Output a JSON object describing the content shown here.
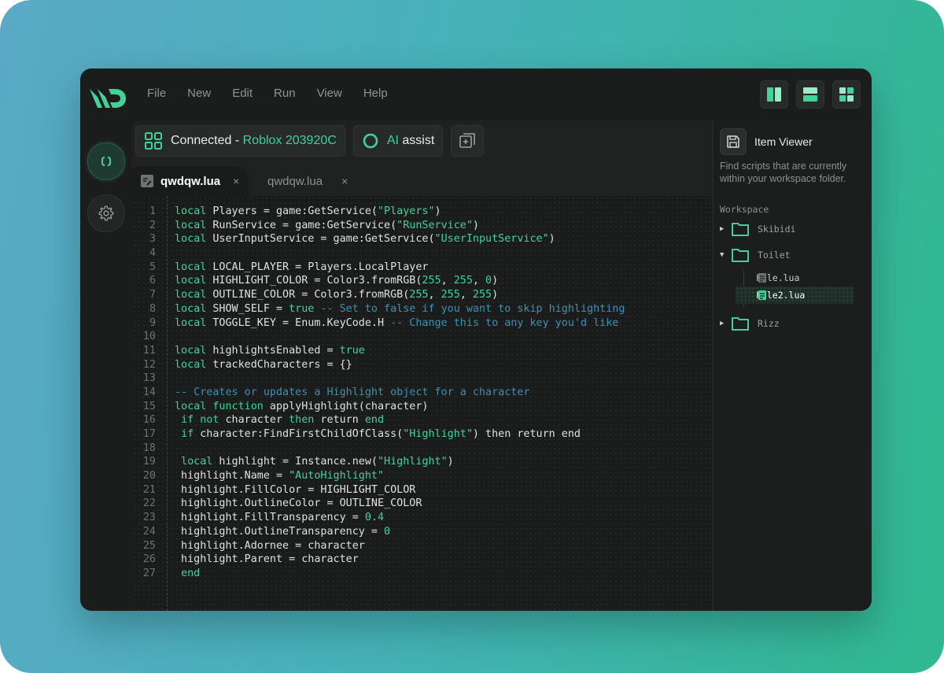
{
  "menu": [
    "File",
    "New",
    "Edit",
    "Run",
    "View",
    "Help"
  ],
  "toolbar": {
    "status_prefix": "Connected",
    "status_sep": " - ",
    "status_target": "Roblox 203920C",
    "ai_label_1": "AI",
    "ai_label_2": "assist"
  },
  "tabs": [
    {
      "name": "qwdqw.lua",
      "close": "×",
      "active": true
    },
    {
      "name": "qwdqw.lua",
      "close": "×",
      "active": false
    }
  ],
  "code_lines": [
    [
      [
        "kw",
        "local"
      ],
      [
        "p",
        " Players = game:GetService("
      ],
      [
        "str",
        "\"Players\""
      ],
      [
        "p",
        ")"
      ]
    ],
    [
      [
        "kw",
        "local"
      ],
      [
        "p",
        " RunService = game:GetService("
      ],
      [
        "str",
        "\"RunService\""
      ],
      [
        "p",
        ")"
      ]
    ],
    [
      [
        "kw",
        "local"
      ],
      [
        "p",
        " UserInputService = game:GetService("
      ],
      [
        "str",
        "\"UserInputService\""
      ],
      [
        "p",
        ")"
      ]
    ],
    [],
    [
      [
        "kw",
        "local"
      ],
      [
        "p",
        " LOCAL_PLAYER = Players.LocalPlayer"
      ]
    ],
    [
      [
        "kw",
        "local"
      ],
      [
        "p",
        " HIGHLIGHT_COLOR = Color3.fromRGB("
      ],
      [
        "num",
        "255"
      ],
      [
        "p",
        ", "
      ],
      [
        "num",
        "255"
      ],
      [
        "p",
        ", "
      ],
      [
        "num",
        "0"
      ],
      [
        "p",
        ")"
      ]
    ],
    [
      [
        "kw",
        "local"
      ],
      [
        "p",
        " OUTLINE_COLOR = Color3.fromRGB("
      ],
      [
        "num",
        "255"
      ],
      [
        "p",
        ", "
      ],
      [
        "num",
        "255"
      ],
      [
        "p",
        ", "
      ],
      [
        "num",
        "255"
      ],
      [
        "p",
        ")"
      ]
    ],
    [
      [
        "kw",
        "local"
      ],
      [
        "p",
        " SHOW_SELF = "
      ],
      [
        "kw",
        "true"
      ],
      [
        "p",
        " "
      ],
      [
        "cm",
        "-- Set to false if you want to skip highlighting"
      ]
    ],
    [
      [
        "kw",
        "local"
      ],
      [
        "p",
        " TOGGLE_KEY = Enum.KeyCode.H "
      ],
      [
        "cm",
        "-- Change this to any key you'd like"
      ]
    ],
    [],
    [
      [
        "kw",
        "local"
      ],
      [
        "p",
        " highlightsEnabled = "
      ],
      [
        "kw",
        "true"
      ]
    ],
    [
      [
        "kw",
        "local"
      ],
      [
        "p",
        " trackedCharacters = {}"
      ]
    ],
    [],
    [
      [
        "cm",
        "-- Creates or updates a Highlight object for a character"
      ]
    ],
    [
      [
        "kw",
        "local"
      ],
      [
        "p",
        " "
      ],
      [
        "kw",
        "function"
      ],
      [
        "p",
        " applyHighlight(character)"
      ]
    ],
    [
      [
        "p",
        " "
      ],
      [
        "kw",
        "if"
      ],
      [
        "p",
        " "
      ],
      [
        "kw",
        "not"
      ],
      [
        "p",
        " character "
      ],
      [
        "kw",
        "then"
      ],
      [
        "p",
        " return "
      ],
      [
        "kw",
        "end"
      ]
    ],
    [
      [
        "p",
        " "
      ],
      [
        "kw",
        "if"
      ],
      [
        "p",
        " character:FindFirstChildOfClass("
      ],
      [
        "str",
        "\"Highlight\""
      ],
      [
        "p",
        ") then return end"
      ]
    ],
    [],
    [
      [
        "p",
        " "
      ],
      [
        "kw",
        "local"
      ],
      [
        "p",
        " highlight = Instance.new("
      ],
      [
        "str",
        "\"Highlight\""
      ],
      [
        "p",
        ")"
      ]
    ],
    [
      [
        "p",
        " highlight.Name = "
      ],
      [
        "str",
        "\"AutoHighlight\""
      ]
    ],
    [
      [
        "p",
        " highlight.FillColor = HIGHLIGHT_COLOR"
      ]
    ],
    [
      [
        "p",
        " highlight.OutlineColor = OUTLINE_COLOR"
      ]
    ],
    [
      [
        "p",
        " highlight.FillTransparency = "
      ],
      [
        "num",
        "0.4"
      ]
    ],
    [
      [
        "p",
        " highlight.OutlineTransparency = "
      ],
      [
        "num",
        "0"
      ]
    ],
    [
      [
        "p",
        " highlight.Adornee = character"
      ]
    ],
    [
      [
        "p",
        " highlight.Parent = character"
      ]
    ],
    [
      [
        "p",
        " "
      ],
      [
        "kw",
        "end"
      ]
    ]
  ],
  "viewer": {
    "title": "Item Viewer",
    "description": "Find scripts that are currently within your workspace folder.",
    "workspace_label": "Workspace",
    "folders": [
      {
        "name": "Skibidi",
        "expanded": false
      },
      {
        "name": "Toilet",
        "expanded": true,
        "files": [
          "File.lua",
          "File2.lua"
        ],
        "selected": "File2.lua"
      },
      {
        "name": "Rizz",
        "expanded": false
      }
    ]
  },
  "colors": {
    "accent": "#43d19a",
    "comment": "#3f8fb0",
    "background": "#1b1d1d"
  }
}
